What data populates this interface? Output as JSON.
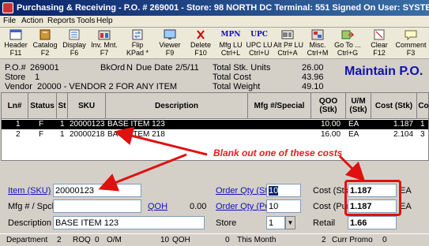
{
  "window": {
    "title": "Purchasing & Receiving - P.O. # 269001  -  Store: 98  NORTH DC   Terminal: 551   Signed On User: SYSTEM"
  },
  "menu": [
    "File",
    "Action",
    "Reports",
    "Tools",
    "Help"
  ],
  "toolbar": [
    {
      "label1": "Header",
      "label2": "F11",
      "icon": "header-icon"
    },
    {
      "label1": "Catalog",
      "label2": "F2",
      "icon": "catalog-icon"
    },
    {
      "label1": "Display",
      "label2": "F6",
      "icon": "display-icon"
    },
    {
      "label1": "Inv. Mnt.",
      "label2": "F7",
      "icon": "inventory-icon"
    },
    {
      "label1": "Flip",
      "label2": "KPad *",
      "icon": "flip-icon"
    },
    {
      "label1": "Viewer",
      "label2": "F9",
      "icon": "viewer-icon"
    },
    {
      "label1": "Delete",
      "label2": "F10",
      "icon": "delete-icon"
    },
    {
      "label1": "Mfg LU",
      "label2": "Ctrl+L",
      "icon": "mpn-icon",
      "icon_text": "MPN"
    },
    {
      "label1": "UPC LU",
      "label2": "Ctrl+U",
      "icon": "upc-icon",
      "icon_text": "UPC"
    },
    {
      "label1": "Alt P# LU",
      "label2": "Ctrl+A",
      "icon": "alt-part-icon"
    },
    {
      "label1": "Misc.",
      "label2": "Ctrl+M",
      "icon": "misc-icon"
    },
    {
      "label1": "Go To ...",
      "label2": "Ctrl+G",
      "icon": "goto-icon"
    },
    {
      "label1": "Clear",
      "label2": "F12",
      "icon": "clear-icon"
    },
    {
      "label1": "Comment",
      "label2": "F3",
      "icon": "comment-icon"
    }
  ],
  "header": {
    "po_label": "P.O.#",
    "po_value": "269001",
    "bkord_label": "BkOrd",
    "bkord_value": "N",
    "due_label": "Due Date",
    "due_value": "2/5/11",
    "store_label": "Store",
    "store_value": "1",
    "vendor_label": "Vendor",
    "vendor_value": "20000 - VENDOR 2 FOR ANY ITEM",
    "total_units_label": "Total Stk. Units",
    "total_units_value": "26.00",
    "total_cost_label": "Total Cost",
    "total_cost_value": "43.96",
    "total_weight_label": "Total Weight",
    "total_weight_value": "49.10",
    "mode_title": "Maintain P.O."
  },
  "grid": {
    "columns": [
      "Ln#",
      "Status",
      "St",
      "SKU",
      "Description",
      "Mfg #/Special",
      "QOO (Stk)",
      "U/M (Stk)",
      "Cost (Stk)",
      "Co"
    ],
    "rows": [
      {
        "ln": "1",
        "status": "F",
        "st": "1",
        "sku": "20000123",
        "desc": "BASE ITEM 123",
        "mfg": "",
        "qoo": "10.00",
        "um": "EA",
        "cost": "1.187",
        "extra": "1"
      },
      {
        "ln": "2",
        "status": "F",
        "st": "1",
        "sku": "20000218",
        "desc": "BASE ITEM 218",
        "mfg": "",
        "qoo": "16.00",
        "um": "EA",
        "cost": "2.104",
        "extra": "3"
      }
    ]
  },
  "form": {
    "item_label": "Item (SKU)",
    "item_value": "20000123",
    "mfg_label": "Mfg # / Spcl",
    "mfg_value": "",
    "qoh_label": "QOH",
    "qoh_value": "0.00",
    "desc_label": "Description",
    "desc_value": "BASE ITEM 123",
    "oq_stk_label": "Order Qty (Stk)",
    "oq_stk_value": "10",
    "oq_pur_label": "Order Qty (Pur)",
    "oq_pur_value": "10",
    "store_label": "Store",
    "store_value": "1",
    "cost_stk_label": "Cost (Stk)",
    "cost_stk_value": "1.187",
    "cost_stk_um": "EA",
    "cost_pur_label": "Cost (Pur)",
    "cost_pur_value": "1.187",
    "cost_pur_um": "EA",
    "retail_label": "Retail",
    "retail_value": "1.66"
  },
  "status_bar": {
    "department_label": "Department",
    "department_value": "2",
    "roq_label": "ROQ",
    "roq_value": "0",
    "om_label": "O/M",
    "om_value": "10",
    "qoh_label": "QOH",
    "qoh_value": "0",
    "this_month_label": "This Month",
    "this_month_value": "2",
    "curr_promo_label": "Curr Promo",
    "curr_promo_value": "0"
  },
  "annotation": {
    "text": "Blank out one of these costs"
  },
  "colors": {
    "title_bar": "#0a246a",
    "selected_row": "#000000",
    "link": "#1010c0",
    "annotation": "#e02020",
    "maintain_title": "#1010b0"
  }
}
